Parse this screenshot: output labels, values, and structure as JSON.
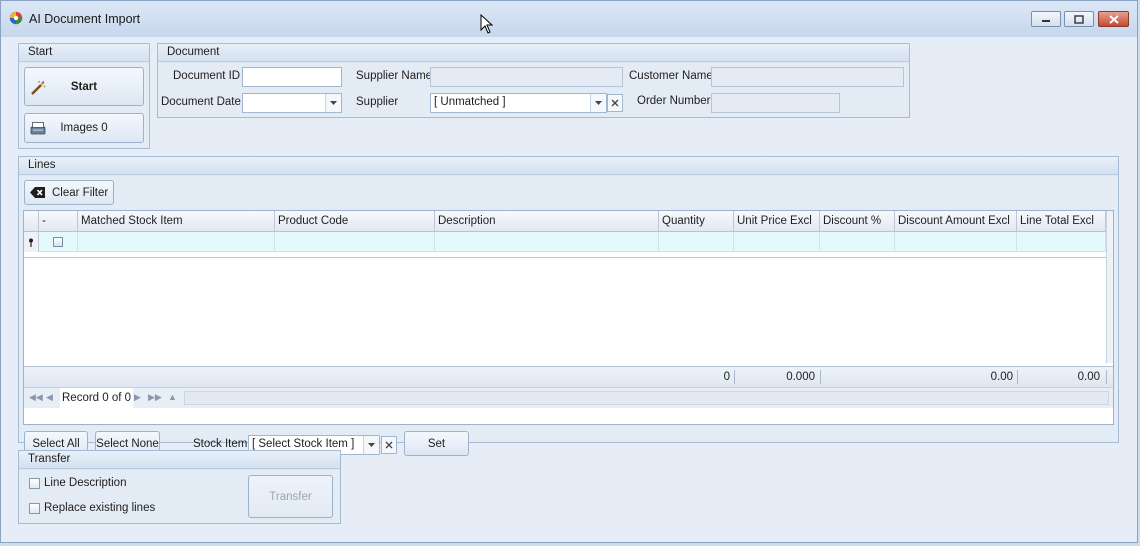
{
  "window": {
    "title": "AI Document Import"
  },
  "start_group": {
    "title": "Start",
    "start_label": "Start",
    "images_label": "Images 0"
  },
  "document_group": {
    "title": "Document",
    "document_id_label": "Document ID",
    "document_id_value": "",
    "document_date_label": "Document Date",
    "document_date_value": "",
    "supplier_name_label": "Supplier Name",
    "supplier_name_value": "",
    "supplier_label": "Supplier",
    "supplier_value": "[ Unmatched ]",
    "customer_name_label": "Customer Name",
    "customer_name_value": "",
    "order_number_label": "Order Number",
    "order_number_value": ""
  },
  "lines_group": {
    "title": "Lines",
    "clear_filter_label": "Clear Filter",
    "columns": [
      "-",
      "Matched Stock Item",
      "Product Code",
      "Description",
      "Quantity",
      "Unit Price Excl",
      "Discount %",
      "Discount Amount Excl",
      "Line Total Excl"
    ],
    "totals": {
      "quantity": "0",
      "unit_price_excl": "0.000",
      "discount_amount_excl": "0.00",
      "line_total_excl": "0.00"
    },
    "record_text": "Record 0 of 0",
    "select_all_label": "Select All",
    "select_none_label": "Select None",
    "stock_item_label": "Stock Item",
    "stock_item_value": "[ Select Stock Item ]",
    "set_label": "Set"
  },
  "transfer_group": {
    "title": "Transfer",
    "line_description_label": "Line Description",
    "line_description_checked": false,
    "replace_lines_label": "Replace existing lines",
    "replace_lines_checked": false,
    "transfer_label": "Transfer"
  },
  "colors": {
    "accent": "#1d58a8",
    "close_button": "#c24a32",
    "new_row_bg": "#e4fafa"
  }
}
